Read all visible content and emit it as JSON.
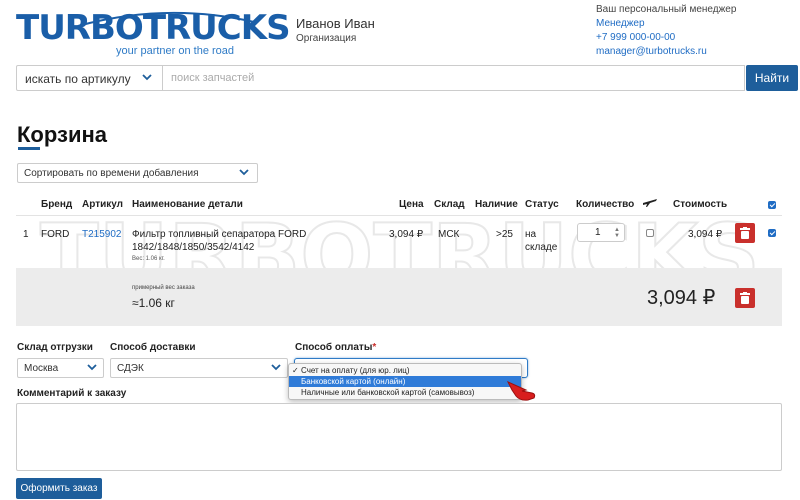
{
  "header": {
    "logo": {
      "word_a": "TURBO",
      "word_b": "TRUCKS",
      "tagline": "your partner on the road"
    },
    "user": {
      "name": "Иванов Иван",
      "org": "Организация"
    },
    "manager": {
      "caption": "Ваш персональный менеджер",
      "role": "Менеджер",
      "phone": "+7 999 000-00-00",
      "email": "manager@turbotrucks.ru"
    }
  },
  "search": {
    "mode": "искать по артикулу",
    "placeholder": "поиск запчастей",
    "button": "Найти"
  },
  "page": {
    "title": "Корзина"
  },
  "sort": {
    "selected": "Сортировать по времени добавления"
  },
  "table": {
    "headers": {
      "brand": "Бренд",
      "article": "Артикул",
      "name": "Наименование детали",
      "price": "Цена",
      "warehouse": "Склад",
      "availability": "Наличие",
      "status": "Статус",
      "quantity": "Количество",
      "cost": "Стоимость"
    },
    "rows": [
      {
        "num": "1",
        "brand": "FORD",
        "article": "T215902",
        "name_line1": "Фильтр топливный сепаратора FORD",
        "name_line2": "1842/1848/1850/3542/4142",
        "weight": "Вес: 1.06 кг.",
        "price": "3,094 ₽",
        "warehouse": "МСК",
        "availability": ">25",
        "status_line1": "на",
        "status_line2": "складе",
        "quantity": "1",
        "cost": "3,094 ₽",
        "air_checked": false,
        "selected": true
      }
    ],
    "select_all": true,
    "summary": {
      "weight_caption": "примерный вес заказа",
      "weight": "≈1.06 кг",
      "total": "3,094 ₽"
    }
  },
  "watermark": {
    "line1": "TURBOTRUCKS",
    "line2": "your partner on the road"
  },
  "form": {
    "warehouse_label": "Склад отгрузки",
    "warehouse_value": "Москва",
    "delivery_label": "Способ доставки",
    "delivery_value": "СДЭК",
    "payment_label": "Способ оплаты",
    "payment_required": "*",
    "payment_options": [
      "Счет на оплату (для юр. лиц)",
      "Банковской картой (онлайн)",
      "Наличные или банковской картой (самовывоз)"
    ],
    "payment_checked_index": 0,
    "payment_highlight_index": 1,
    "comment_label": "Комментарий к заказу",
    "submit": "Оформить заказ"
  },
  "colors": {
    "brand_blue": "#1e5e9b",
    "link_blue": "#1f6cc4",
    "danger_red": "#c9302c",
    "highlight_blue": "#2f7bd8"
  },
  "icons": {
    "chevron": "chevron-down-icon",
    "plane": "airplane-icon",
    "trash": "trash-icon",
    "cursor": "hand-pointer-icon"
  }
}
